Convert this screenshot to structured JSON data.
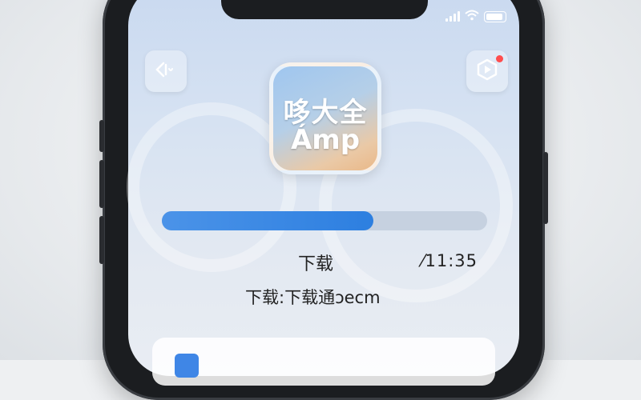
{
  "status_bar": {
    "signal_icon": "cellular-signal-icon",
    "wifi_icon": "wifi-icon",
    "battery_icon": "battery-icon"
  },
  "top_left_button": {
    "icon": "sound-wave-icon"
  },
  "top_right_button": {
    "icon": "video-play-icon",
    "has_notification": true
  },
  "app_icon": {
    "line1": "哆大全",
    "line2": "Ámp"
  },
  "progress": {
    "fraction": 0.65,
    "color": "#3b88e6"
  },
  "download": {
    "label": "下载",
    "time": "⁄11:35",
    "status": "下载:下载通ɔecm"
  },
  "colors": {
    "accent": "#3b88e6",
    "notification": "#ff4d4d"
  }
}
